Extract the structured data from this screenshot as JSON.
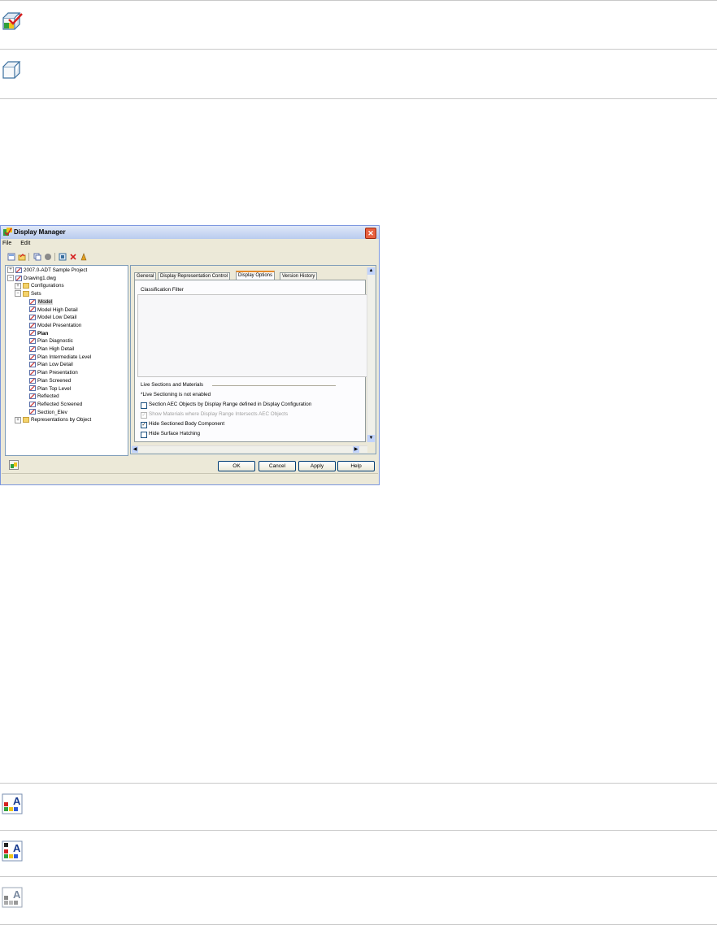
{
  "window": {
    "title": "Display Manager",
    "close_glyph": "✕"
  },
  "menu": [
    "File",
    "Edit"
  ],
  "tree": [
    {
      "label": "2007.0-ADT Sample Project",
      "expander": "+",
      "icon": "project-icon",
      "indent": 0
    },
    {
      "label": "Drawing1.dwg",
      "expander": "−",
      "icon": "drawing-icon",
      "indent": 0
    },
    {
      "label": "Configurations",
      "expander": "+",
      "icon": "folder-icon",
      "indent": 1
    },
    {
      "label": "Sets",
      "expander": "−",
      "icon": "folder-icon",
      "indent": 1
    },
    {
      "label": "Model",
      "icon": "display-set-icon",
      "indent": 2,
      "selected": true
    },
    {
      "label": "Model High Detail",
      "icon": "display-set-icon",
      "indent": 2
    },
    {
      "label": "Model Low Detail",
      "icon": "display-set-icon",
      "indent": 2
    },
    {
      "label": "Model Presentation",
      "icon": "display-set-icon",
      "indent": 2
    },
    {
      "label": "Plan",
      "icon": "display-set-icon",
      "indent": 2,
      "bold": true
    },
    {
      "label": "Plan Diagnostic",
      "icon": "display-set-icon",
      "indent": 2
    },
    {
      "label": "Plan High Detail",
      "icon": "display-set-icon",
      "indent": 2
    },
    {
      "label": "Plan Intermediate Level",
      "icon": "display-set-icon",
      "indent": 2
    },
    {
      "label": "Plan Low Detail",
      "icon": "display-set-icon",
      "indent": 2
    },
    {
      "label": "Plan Presentation",
      "icon": "display-set-icon",
      "indent": 2
    },
    {
      "label": "Plan Screened",
      "icon": "display-set-icon",
      "indent": 2
    },
    {
      "label": "Plan Top Level",
      "icon": "display-set-icon",
      "indent": 2
    },
    {
      "label": "Reflected",
      "icon": "display-set-icon",
      "indent": 2
    },
    {
      "label": "Reflected Screened",
      "icon": "display-set-icon",
      "indent": 2
    },
    {
      "label": "Section_Elev",
      "icon": "display-set-icon",
      "indent": 2
    },
    {
      "label": "Representations by Object",
      "expander": "+",
      "icon": "folder-icon",
      "indent": 1
    }
  ],
  "tabs": [
    {
      "label": "General",
      "active": false
    },
    {
      "label": "Display Representation Control",
      "active": false
    },
    {
      "label": "Display Options",
      "active": true
    },
    {
      "label": "Version History",
      "active": false
    }
  ],
  "panel": {
    "classification_label": "Classification Filter",
    "live_sections_label": "Live Sections and Materials",
    "live_note": "*Live Sectioning is not enabled",
    "options": [
      {
        "label": "Section AEC Objects by Display Range defined in Display Configuration",
        "checked": false,
        "enabled": true
      },
      {
        "label": "Show Materials where Display Range Intersects AEC Objects",
        "checked": true,
        "enabled": false
      },
      {
        "label": "Hide Sectioned Body Component",
        "checked": true,
        "enabled": true
      },
      {
        "label": "Hide Surface Hatching",
        "checked": false,
        "enabled": true
      }
    ]
  },
  "buttons": {
    "ok": "OK",
    "cancel": "Cancel",
    "apply": "Apply",
    "help": "Help"
  },
  "colors": {
    "accent_tab": "#e68b2c",
    "title_bar": "#b9cbee",
    "dialog_bg": "#ece9d8"
  }
}
